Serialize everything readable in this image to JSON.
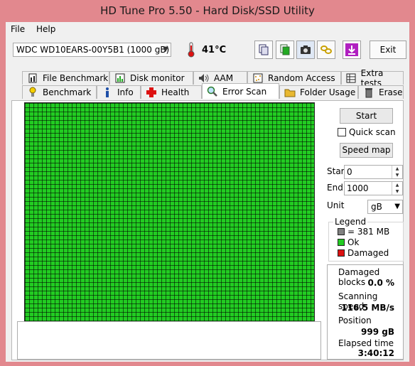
{
  "window": {
    "title": "HD Tune Pro 5.50 - Hard Disk/SSD Utility"
  },
  "menu": {
    "file": "File",
    "help": "Help"
  },
  "toolbar": {
    "drive": "WDC WD10EARS-00Y5B1 (1000 gB)",
    "temperature": "41°C",
    "exit_label": "Exit",
    "icons": [
      "copy-text-icon",
      "copy-screenshot-icon",
      "camera-icon",
      "chain-link-icon",
      "download-arrow-icon"
    ]
  },
  "tabs_top": [
    {
      "label": "File Benchmark",
      "icon": "file-benchmark-icon"
    },
    {
      "label": "Disk monitor",
      "icon": "disk-monitor-icon"
    },
    {
      "label": "AAM",
      "icon": "speaker-icon"
    },
    {
      "label": "Random Access",
      "icon": "random-access-icon"
    },
    {
      "label": "Extra tests",
      "icon": "extra-tests-icon"
    }
  ],
  "tabs_bottom": [
    {
      "label": "Benchmark",
      "icon": "benchmark-icon"
    },
    {
      "label": "Info",
      "icon": "info-icon"
    },
    {
      "label": "Health",
      "icon": "health-cross-icon"
    },
    {
      "label": "Error Scan",
      "icon": "magnifier-icon",
      "active": true
    },
    {
      "label": "Folder Usage",
      "icon": "folder-icon"
    },
    {
      "label": "Erase",
      "icon": "trash-icon"
    }
  ],
  "controls": {
    "start_button": "Start",
    "quick_scan": "Quick scan",
    "quick_scan_checked": false,
    "speed_map_button": "Speed map",
    "start_label": "Start",
    "start_value": "0",
    "end_label": "End",
    "end_value": "1000",
    "unit_label": "Unit",
    "unit_value": "gB"
  },
  "legend": {
    "title": "Legend",
    "items": [
      {
        "label": "= 381 MB",
        "color": "#808080"
      },
      {
        "label": "Ok",
        "color": "#22cc22"
      },
      {
        "label": "Damaged",
        "color": "#dd1111"
      }
    ]
  },
  "stats": {
    "damaged_label": "Damaged blocks",
    "damaged_value": "0.0 %",
    "speed_label": "Scanning speed",
    "speed_value": "116.5 MB/s",
    "position_label": "Position",
    "position_value": "999 gB",
    "elapsed_label": "Elapsed time",
    "elapsed_value": "3:40:12"
  },
  "colors": {
    "scan_ok": "#22cc22",
    "titlebar": "#e2888e"
  }
}
